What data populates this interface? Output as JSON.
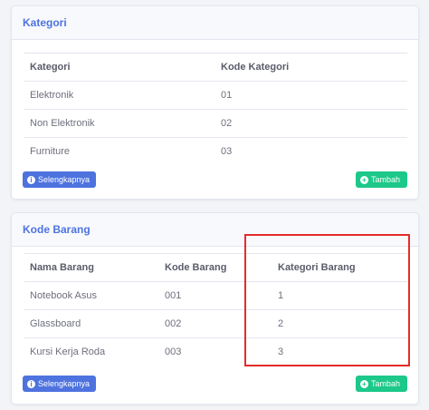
{
  "kategori_card": {
    "title": "Kategori",
    "columns": [
      "Kategori",
      "Kode Kategori"
    ],
    "rows": [
      [
        "Elektronik",
        "01"
      ],
      [
        "Non Elektronik",
        "02"
      ],
      [
        "Furniture",
        "03"
      ]
    ],
    "more_button": "Selengkapnya",
    "add_button": "Tambah"
  },
  "kode_barang_card": {
    "title": "Kode Barang",
    "columns": [
      "Nama Barang",
      "Kode Barang",
      "Kategori Barang"
    ],
    "rows": [
      [
        "Notebook Asus",
        "001",
        "1"
      ],
      [
        "Glassboard",
        "002",
        "2"
      ],
      [
        "Kursi Kerja Roda",
        "003",
        "3"
      ]
    ],
    "more_button": "Selengkapnya",
    "add_button": "Tambah"
  },
  "icons": {
    "info": "info-circle-icon",
    "add": "plus-circle-icon"
  },
  "colors": {
    "primary": "#4e73df",
    "success": "#1cc88a",
    "highlight": "#e52b2b"
  }
}
